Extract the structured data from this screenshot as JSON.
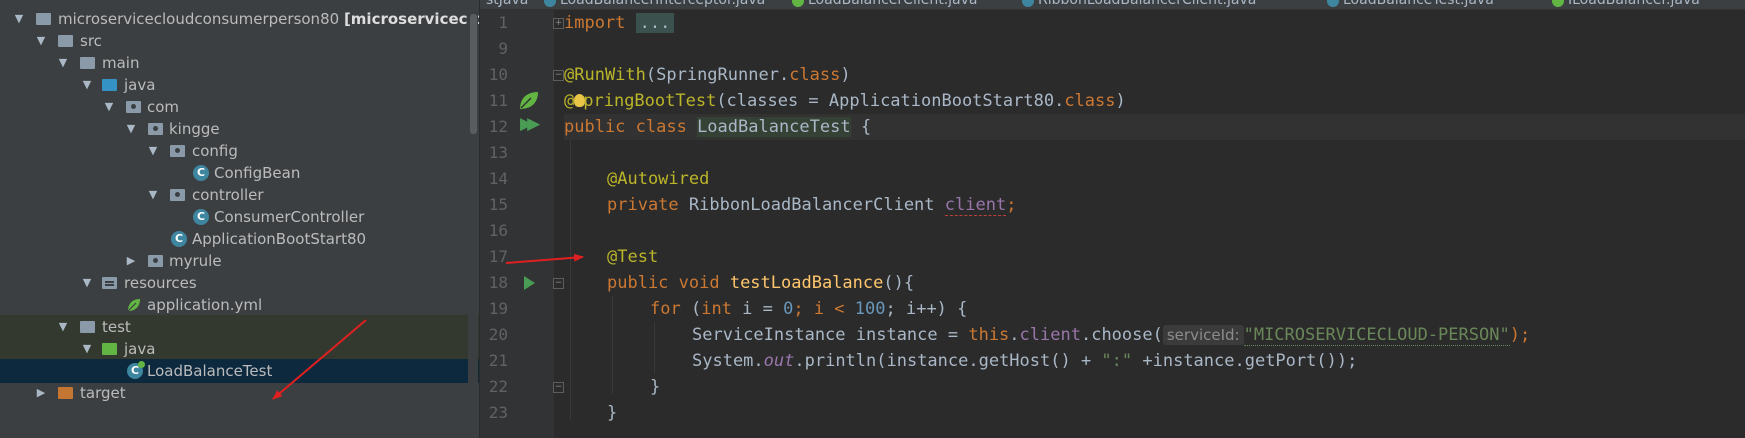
{
  "project_tree": {
    "root": {
      "label": "microservicecloudconsumerperson80",
      "module_tag": "[microservicecloud"
    },
    "items": [
      {
        "label": "src"
      },
      {
        "label": "main"
      },
      {
        "label": "java"
      },
      {
        "label": "com"
      },
      {
        "label": "kingge"
      },
      {
        "label": "config"
      },
      {
        "label": "ConfigBean"
      },
      {
        "label": "controller"
      },
      {
        "label": "ConsumerController"
      },
      {
        "label": "ApplicationBootStart80"
      },
      {
        "label": "myrule"
      },
      {
        "label": "resources"
      },
      {
        "label": "application.yml"
      },
      {
        "label": "test"
      },
      {
        "label": "java"
      },
      {
        "label": "LoadBalanceTest"
      },
      {
        "label": "target"
      }
    ]
  },
  "tabs": [
    {
      "label": "stJava"
    },
    {
      "label": "LoadBalancerInterceptor.java"
    },
    {
      "label": "LoadBalancerClient.java"
    },
    {
      "label": "RibbonLoadBalancerClient.java"
    },
    {
      "label": "LoadBalanceTest.java"
    },
    {
      "label": "ILoadBalancer.java"
    }
  ],
  "editor": {
    "line_numbers": [
      "1",
      "9",
      "10",
      "11",
      "12",
      "13",
      "14",
      "15",
      "16",
      "17",
      "18",
      "19",
      "20",
      "21",
      "22",
      "23"
    ],
    "code": {
      "l1_kw": "import",
      "l1_fold": "...",
      "l10_ann": "@RunWith",
      "l10_rest": "(SpringRunner.",
      "l10_kw": "class",
      "l10_end": ")",
      "l11_at": "@",
      "l11_ann": "pringBootTest",
      "l11_rest": "(classes = ApplicationBootStart80.",
      "l11_kw": "class",
      "l11_end": ")",
      "l12_kw": "public class ",
      "l12_cls": "LoadBalanceTest",
      "l12_end": " {",
      "l14_ann": "@Autowired",
      "l15_kw": "private ",
      "l15_type": "RibbonLoadBalancerClient ",
      "l15_fld": "client",
      "l15_end": ";",
      "l17_ann": "@Test",
      "l18_kw": "public void ",
      "l18_fn": "testLoadBalance",
      "l18_end": "(){",
      "l19_kw": "for ",
      "l19_a": "(",
      "l19_kw2": "int ",
      "l19_b": "i = ",
      "l19_n1": "0",
      "l19_c": "; i < ",
      "l19_n2": "100",
      "l19_d": "; i++) {",
      "l20_a": "ServiceInstance instance = ",
      "l20_kw": "this",
      "l20_dot": ".",
      "l20_fld": "client",
      "l20_b": ".choose(",
      "l20_hint": "serviceId:",
      "l20_str": "\"MICROSERVICECLOUD-PERSON\"",
      "l20_end": ");",
      "l21_a": "System.",
      "l21_static": "out",
      "l21_b": ".println(instance.getHost() + ",
      "l21_str": "\":\"",
      "l21_c": " +instance.getPort());",
      "l22": "}",
      "l23": "}"
    }
  },
  "colors": {
    "background": "#2b2b2b",
    "tree_background": "#3c3f41",
    "selection": "#0d293e",
    "keyword": "#cc7832",
    "annotation": "#bbb529",
    "string": "#6a8759",
    "number": "#6897bb",
    "field": "#9876aa",
    "arrow": "#e02020"
  }
}
